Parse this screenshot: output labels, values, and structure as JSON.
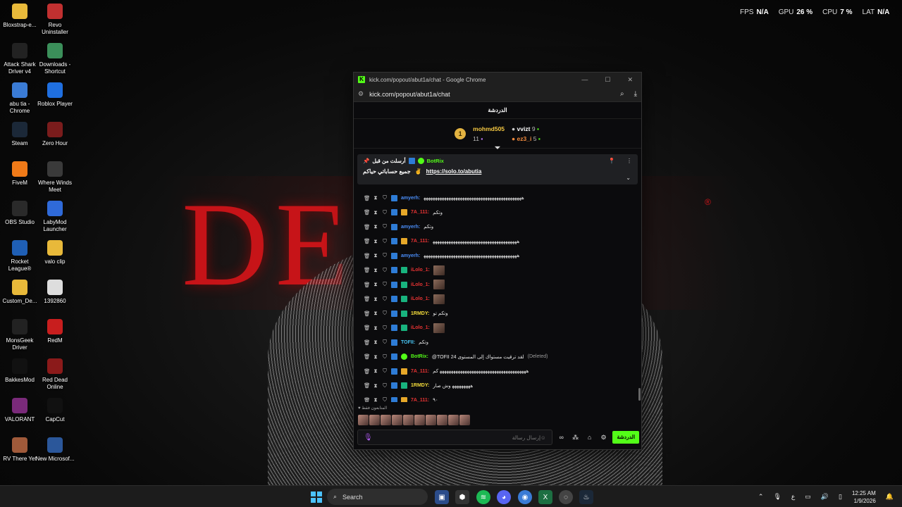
{
  "wallpaper": {
    "text": "DEV  R",
    "mark": "®"
  },
  "desktop_icons": [
    {
      "label": "Bloxstrap-e...",
      "icon": "folder-icon",
      "color": "#e8b93a"
    },
    {
      "label": "Revo Uninstaller",
      "icon": "revo-icon",
      "color": "#c03030"
    },
    {
      "label": "Attack Shark Driver v4",
      "icon": "shark-icon",
      "color": "#222222"
    },
    {
      "label": "Downloads - Shortcut",
      "icon": "download-icon",
      "color": "#3b8f5a"
    },
    {
      "label": "abu tia - Chrome",
      "icon": "chrome-icon",
      "color": "#3a7bd5"
    },
    {
      "label": "Roblox Player",
      "icon": "roblox-icon",
      "color": "#1f6fe0"
    },
    {
      "label": "Steam",
      "icon": "steam-icon",
      "color": "#1b2838"
    },
    {
      "label": "Zero Hour",
      "icon": "zero-hour-icon",
      "color": "#7a1c1c"
    },
    {
      "label": "FiveM",
      "icon": "fivem-icon",
      "color": "#f07a18"
    },
    {
      "label": "Where Winds Meet",
      "icon": "wwm-icon",
      "color": "#3a3a3a"
    },
    {
      "label": "OBS Studio",
      "icon": "obs-icon",
      "color": "#2a2a2a"
    },
    {
      "label": "LabyMod Launcher",
      "icon": "labymod-icon",
      "color": "#2f6ad9"
    },
    {
      "label": "Rocket League®",
      "icon": "rocket-league-icon",
      "color": "#1f5fb5"
    },
    {
      "label": "valo clip",
      "icon": "folder-icon",
      "color": "#e8b93a"
    },
    {
      "label": "Custom_De...",
      "icon": "folder-icon",
      "color": "#e8b93a"
    },
    {
      "label": "1392860",
      "icon": "file-icon",
      "color": "#dddddd"
    },
    {
      "label": "MonsGeek Driver",
      "icon": "monsgeek-icon",
      "color": "#222222"
    },
    {
      "label": "RedM",
      "icon": "redm-icon",
      "color": "#c81e1e"
    },
    {
      "label": "BakkesMod",
      "icon": "bakkesmod-icon",
      "color": "#111111"
    },
    {
      "label": "Red Dead Online",
      "icon": "rdo-icon",
      "color": "#8b1a1a"
    },
    {
      "label": "VALORANT",
      "icon": "valorant-icon",
      "color": "#7a2a7a"
    },
    {
      "label": "CapCut",
      "icon": "capcut-icon",
      "color": "#111111"
    },
    {
      "label": "RV There Yet",
      "icon": "rv-icon",
      "color": "#a05a3a"
    },
    {
      "label": "New Microsof...",
      "icon": "word-icon",
      "color": "#2b579a"
    }
  ],
  "perf_overlay": {
    "fps_label": "FPS",
    "fps_value": "N/A",
    "gpu_label": "GPU",
    "gpu_value": "26 %",
    "cpu_label": "CPU",
    "cpu_value": "7 %",
    "lat_label": "LAT",
    "lat_value": "N/A"
  },
  "window": {
    "title": "kick.com/popout/abut1a/chat - Google Chrome",
    "url": "kick.com/popout/abut1a/chat",
    "chat_title": "الدردشة"
  },
  "leaderboard": {
    "rank": "1",
    "first": {
      "name": "mohmd505",
      "count": "11"
    },
    "second": {
      "name": "vvizt",
      "count": "9"
    },
    "third": {
      "name": "ez3_i",
      "count": "5"
    }
  },
  "pinned": {
    "pinned_by_label": "أرسلت من قبل",
    "author": "BotRix",
    "text": "جميع حساباتي حياكم",
    "emoji": "✌️",
    "link": "https://solo.to/abutia"
  },
  "messages": [
    {
      "user": "amyerh:",
      "text": "ﻫﻬﻬﻬﻬﻬﻬﻬﻬﻬﻬﻬﻬﻬﻬﻬﻬﻬﻬﻬﻬﻬﻬﻬﻬﻬﻬﻬﻬﻬﻬﻬﻬﻬﻬﻬﻬﻬﻬﻬﻬﻬﻬﻬ",
      "color": "u-blue",
      "crown": false,
      "sub": false
    },
    {
      "user": "7A_111:",
      "text": "وتكم",
      "color": "u-red",
      "crown": true,
      "sub": false
    },
    {
      "user": "amyerh:",
      "text": "وتكم",
      "color": "u-blue",
      "crown": false,
      "sub": false
    },
    {
      "user": "7A_111:",
      "text": "ﻫﻬﻬﻬﻬﻬﻬﻬﻬﻬﻬﻬﻬﻬﻬﻬﻬﻬﻬﻬﻬﻬﻬﻬﻬﻬﻬﻬﻬﻬﻬﻬﻬﻬﻬﻬﻬﻬ",
      "color": "u-red",
      "crown": true,
      "sub": false
    },
    {
      "user": "amyerh:",
      "text": "ﻫﻬﻬﻬﻬﻬﻬﻬﻬﻬﻬﻬﻬﻬﻬﻬﻬﻬﻬﻬﻬﻬﻬﻬﻬﻬﻬﻬﻬﻬﻬﻬﻬﻬﻬﻬﻬﻬﻬﻬﻬﻬ",
      "color": "u-blue",
      "crown": false,
      "sub": false
    },
    {
      "user": "iLolo_1:",
      "text": "",
      "color": "u-red",
      "crown": false,
      "sub": true,
      "emote": true
    },
    {
      "user": "iLolo_1:",
      "text": "",
      "color": "u-red",
      "crown": false,
      "sub": true,
      "emote": true
    },
    {
      "user": "iLolo_1:",
      "text": "",
      "color": "u-red",
      "crown": false,
      "sub": true,
      "emote": true
    },
    {
      "user": "1RMDY:",
      "text": "وتكم تو",
      "color": "u-yellow",
      "crown": false,
      "sub": true
    },
    {
      "user": "iLolo_1:",
      "text": "",
      "color": "u-red",
      "crown": false,
      "sub": true,
      "emote": true
    },
    {
      "user": "TOFII:",
      "text": "وتكم",
      "color": "u-cyan",
      "crown": false,
      "sub": false
    },
    {
      "user": "BotRix:",
      "text": "@TOFII 24 لقد ترقيت مستواك إلى المستوى",
      "color": "u-green",
      "crown": false,
      "sub": false,
      "deleted": "(Deleted)",
      "bot": true
    },
    {
      "user": "7A_111:",
      "text": "ﻫﻬﻬﻬﻬﻬﻬﻬﻬﻬﻬﻬﻬﻬﻬﻬﻬﻬﻬﻬﻬﻬﻬﻬﻬﻬﻬﻬﻬﻬﻬﻬﻬﻬﻬﻬﻬﻬﻬ كم",
      "color": "u-red",
      "crown": true,
      "sub": false
    },
    {
      "user": "1RMDY:",
      "text": "ﻫﻬﻬﻬﻬﻬﻬﻬﻬ وش صار",
      "color": "u-yellow",
      "crown": false,
      "sub": true
    },
    {
      "user": "7A_111:",
      "text": "٩٠",
      "color": "u-red",
      "crown": true,
      "sub": false
    }
  ],
  "supporters_label": "المتابعون فقط",
  "composer": {
    "placeholder": "إرسال رسالة",
    "send_label": "الدردشة"
  },
  "taskbar": {
    "search_label": "Search",
    "lang": "ع",
    "time": "12:25 AM",
    "date": "1/9/2026"
  }
}
